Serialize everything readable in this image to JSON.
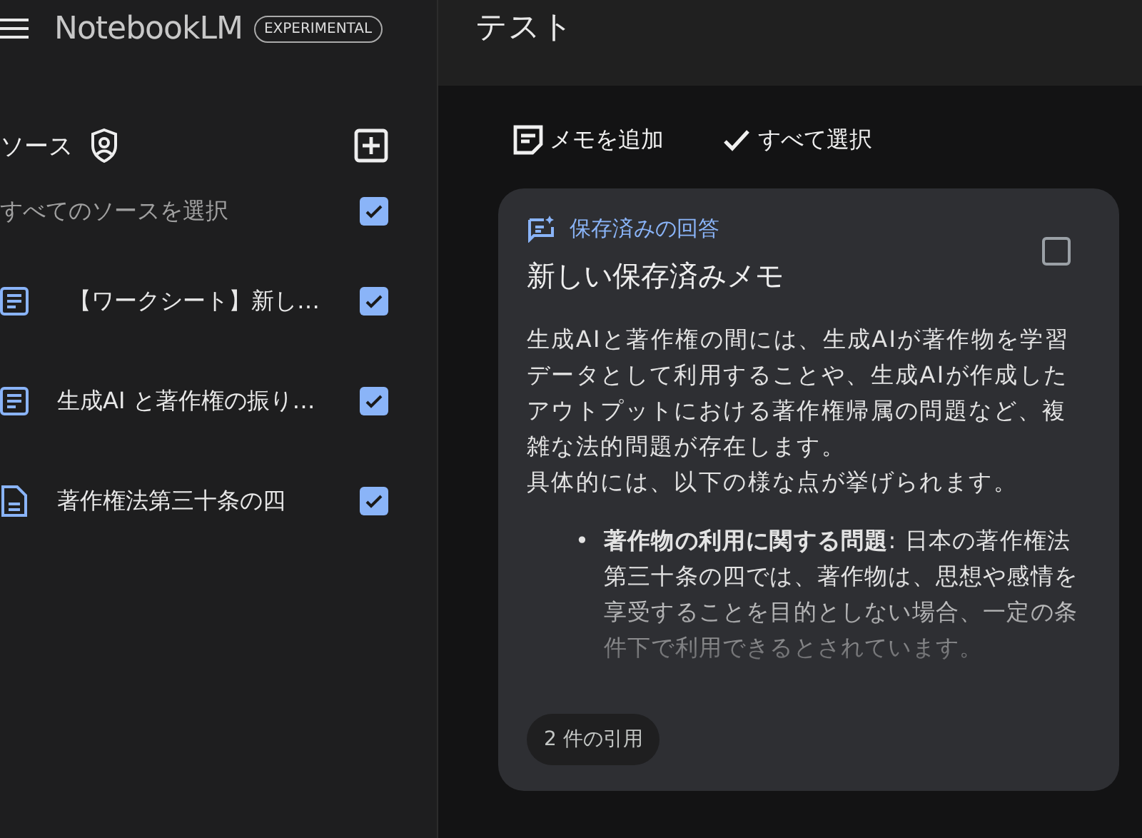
{
  "app": {
    "name": "NotebookLM",
    "badge": "EXPERIMENTAL"
  },
  "sources": {
    "title": "ソース",
    "select_all": {
      "label": "すべてのソースを選択",
      "checked": true
    },
    "items": [
      {
        "label": "【ワークシート】新し…",
        "checked": true,
        "kind": "note"
      },
      {
        "label": "生成AI と著作権の振り…",
        "checked": true,
        "kind": "note"
      },
      {
        "label": "著作権法第三十条の四",
        "checked": true,
        "kind": "file"
      }
    ]
  },
  "notebook": {
    "title": "テスト",
    "actions": [
      {
        "label": "メモを追加",
        "kind": "add"
      },
      {
        "label": "すべて選択",
        "kind": "check"
      }
    ]
  },
  "note": {
    "tag": "保存済みの回答",
    "title": "新しい保存済みメモ",
    "checked": false,
    "paragraphs": [
      "生成AIと著作権の間には、生成AIが著作物を学習データとして利用することや、生成AIが作成したアウトプットにおける著作権帰属の問題など、複雑な法的問題が存在します。",
      "具体的には、以下の様な点が挙げられます。"
    ],
    "bullet_marker": "•",
    "bullets": [
      "**著作物の利用に関する問題**: 日本の著作権法第三十条の四では、著作物は、思想や感情を享受することを目的としない場合、一定の条件下で利用できるとされています。"
    ],
    "citations": "2 件の引用"
  }
}
